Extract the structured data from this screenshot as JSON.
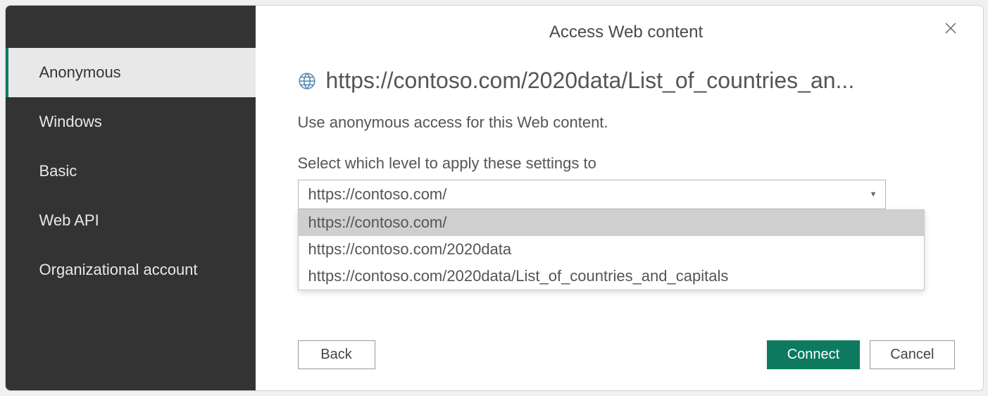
{
  "dialog": {
    "title": "Access Web content"
  },
  "sidebar": {
    "items": [
      {
        "label": "Anonymous",
        "selected": true
      },
      {
        "label": "Windows",
        "selected": false
      },
      {
        "label": "Basic",
        "selected": false
      },
      {
        "label": "Web API",
        "selected": false
      },
      {
        "label": "Organizational account",
        "selected": false
      }
    ]
  },
  "main": {
    "url": "https://contoso.com/2020data/List_of_countries_an...",
    "description": "Use anonymous access for this Web content.",
    "level_label": "Select which level to apply these settings to",
    "level_selected": "https://contoso.com/",
    "level_options": [
      "https://contoso.com/",
      "https://contoso.com/2020data",
      "https://contoso.com/2020data/List_of_countries_and_capitals"
    ]
  },
  "buttons": {
    "back": "Back",
    "connect": "Connect",
    "cancel": "Cancel"
  }
}
